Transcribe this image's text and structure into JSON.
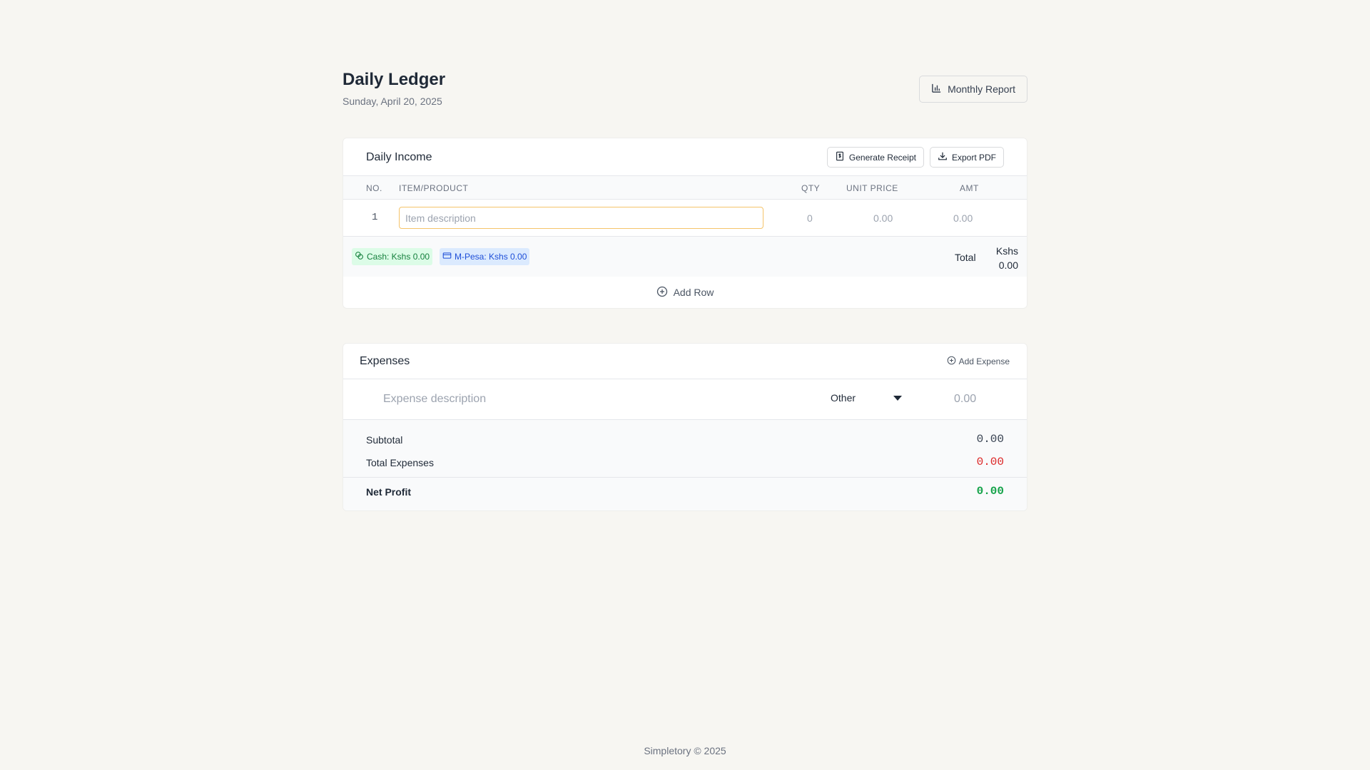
{
  "header": {
    "title": "Daily Ledger",
    "date": "Sunday, April 20, 2025",
    "monthly_report_label": "Monthly Report"
  },
  "income": {
    "title": "Daily Income",
    "generate_receipt_label": "Generate Receipt",
    "export_pdf_label": "Export PDF",
    "columns": [
      "NO.",
      "ITEM/PRODUCT",
      "QTY",
      "UNIT PRICE",
      "AMT"
    ],
    "rows": [
      {
        "no": "1",
        "item_placeholder": "Item description",
        "qty": "0",
        "unit_price": "0.00",
        "amt": "0.00"
      }
    ],
    "cash_badge": "Cash: Kshs 0.00",
    "mpesa_badge": "M-Pesa: Kshs 0.00",
    "total_label": "Total",
    "total_value": "Kshs 0.00",
    "add_row_label": "Add Row"
  },
  "expenses": {
    "title": "Expenses",
    "add_expense_label": "Add Expense",
    "row": {
      "description_placeholder": "Expense description",
      "category": "Other",
      "amount": "0.00"
    },
    "subtotal_label": "Subtotal",
    "subtotal_value": "0.00",
    "total_expenses_label": "Total Expenses",
    "total_expenses_value": "0.00",
    "net_profit_label": "Net Profit",
    "net_profit_value": "0.00"
  },
  "footer": {
    "text": "Simpletory © 2025"
  },
  "colors": {
    "background": "#f7f6f2",
    "accent_input_border": "#f5c46a",
    "cash_bg": "#dcfce7",
    "cash_text": "#15803d",
    "mpesa_bg": "#dbeafe",
    "mpesa_text": "#1d4ed8",
    "expense_red": "#dc2626",
    "profit_green": "#16a34a"
  },
  "icons": {
    "monthly_report": "bar-chart-icon",
    "generate_receipt": "receipt-icon",
    "export_pdf": "download-icon",
    "cash": "coins-icon",
    "mpesa": "credit-card-icon",
    "add_row": "plus-circle-icon",
    "add_expense": "plus-circle-icon",
    "select": "caret-down-icon"
  }
}
